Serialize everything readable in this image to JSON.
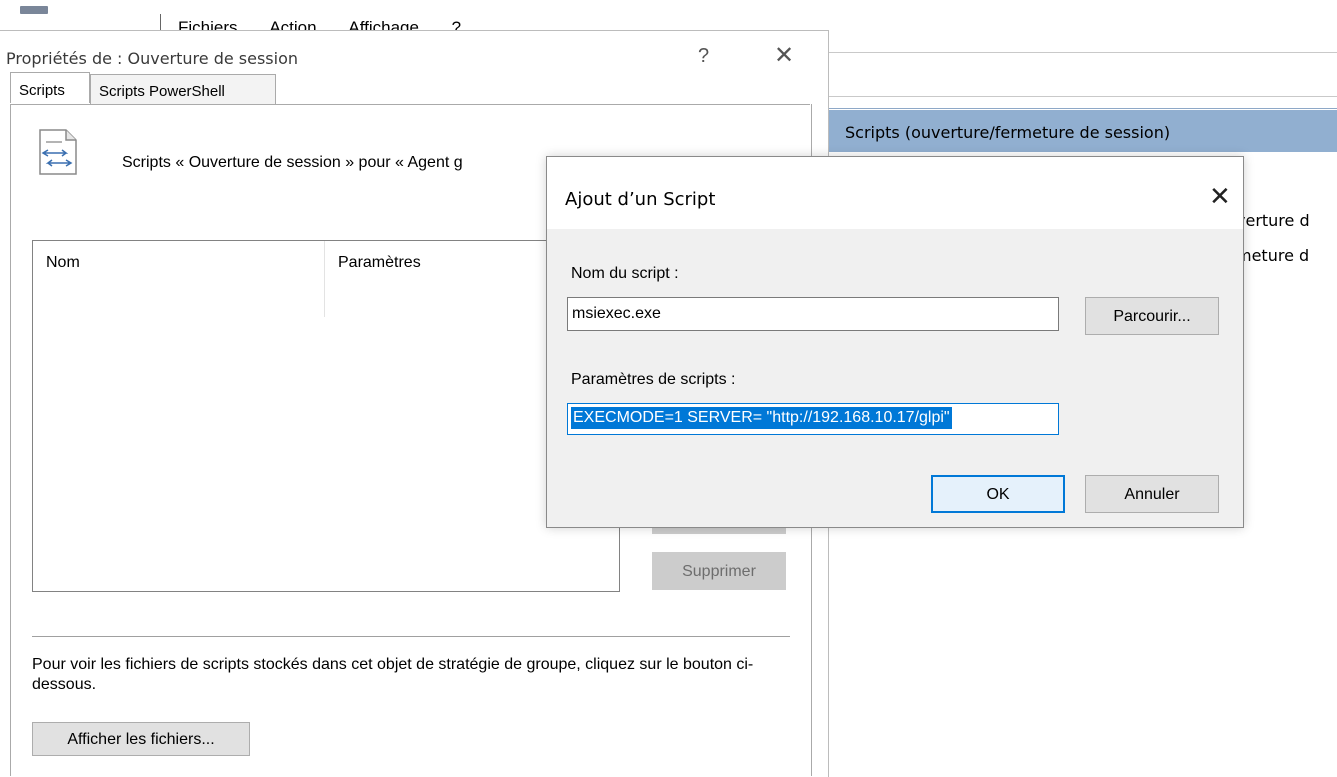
{
  "background_window": {
    "menu_items": [
      "Fichiers",
      "Action",
      "Affichage",
      "?"
    ],
    "pane_header": "Scripts (ouverture/fermeture de session)",
    "rows": [
      "verture d",
      "meture d"
    ]
  },
  "properties_dialog": {
    "title": "Propriétés de : Ouverture de session",
    "help_label": "?",
    "close_label": "✕",
    "tabs": [
      "Scripts",
      "Scripts PowerShell"
    ],
    "heading": "Scripts « Ouverture de session » pour « Agent g",
    "columns": [
      "Nom",
      "Paramètres"
    ],
    "remove_button": "Supprimer",
    "info_text": "Pour voir les fichiers de scripts stockés dans cet objet de stratégie de groupe, cliquez sur le bouton ci-dessous.",
    "show_files_button": "Afficher les fichiers..."
  },
  "add_script_dialog": {
    "title": "Ajout d’un Script",
    "close_label": "✕",
    "script_name_label": "Nom du script :",
    "script_name_value": "msiexec.exe",
    "browse_button": "Parcourir...",
    "params_label": "Paramètres de scripts :",
    "params_value": "EXECMODE=1 SERVER= \"http://192.168.10.17/glpi\"",
    "ok_button": "OK",
    "cancel_button": "Annuler"
  },
  "colors": {
    "accent": "#0078d7",
    "pane_header_bg": "#91afd0"
  }
}
